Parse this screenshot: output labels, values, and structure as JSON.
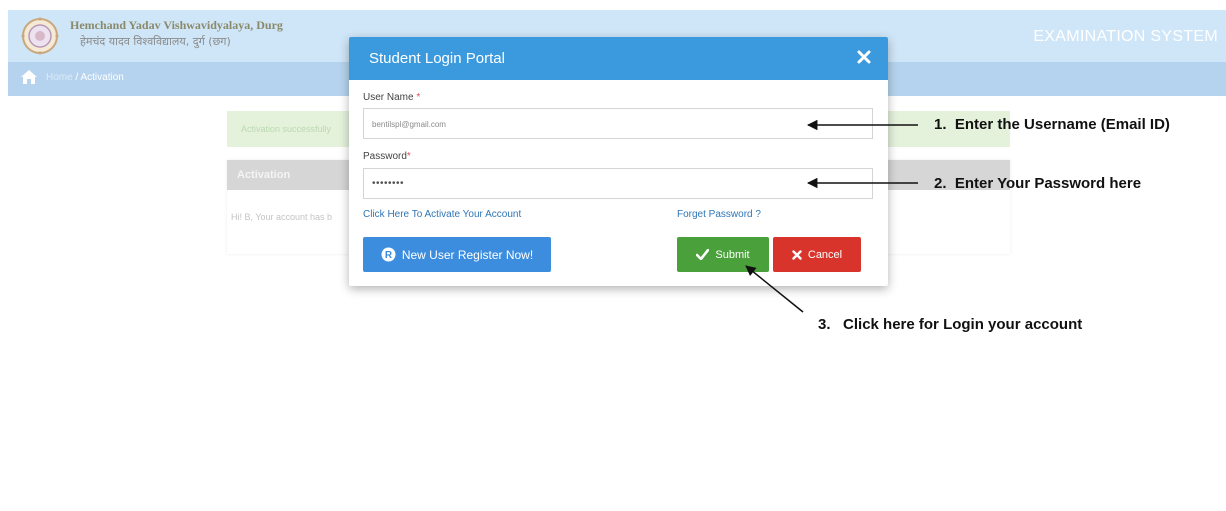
{
  "header": {
    "university_en": "Hemchand Yadav Vishwavidyalaya, Durg",
    "university_hi": "हेमचंद यादव विश्वविद्यालय, दुर्ग (छग)",
    "system_title": "EXAMINATION SYSTEM"
  },
  "breadcrumb": {
    "home": "Home",
    "separator": " / ",
    "current": "Activation"
  },
  "page": {
    "alert_text": "Activation successfully",
    "panel_title": "Activation",
    "panel_body": "Hi! B, Your account has b"
  },
  "modal": {
    "title": "Student Login Portal",
    "username_label": "User Name",
    "username_required": "*",
    "username_value": "bentilspl@gmail.com",
    "password_label": "Password",
    "password_required": "*",
    "password_value": "••••••••",
    "activate_link": "Click Here To Activate Your Account",
    "forget_link": "Forget Password ?",
    "register_button": "New User Register Now!",
    "submit_button": "Submit",
    "cancel_button": "Cancel"
  },
  "annotations": {
    "step1_num": "1.",
    "step1_text": "Enter the Username (Email ID)",
    "step2_num": "2.",
    "step2_text": "Enter Your Password here",
    "step3_num": "3.",
    "step3_text": "Click here for Login your account"
  },
  "colors": {
    "modal_header": "#3b9ade",
    "submit": "#4aa03a",
    "cancel": "#d9342b",
    "register": "#3c8dde",
    "link": "#2f76b6"
  },
  "icons": [
    "university-logo-icon",
    "home-icon",
    "close-icon",
    "registered-icon",
    "check-icon",
    "x-icon"
  ]
}
